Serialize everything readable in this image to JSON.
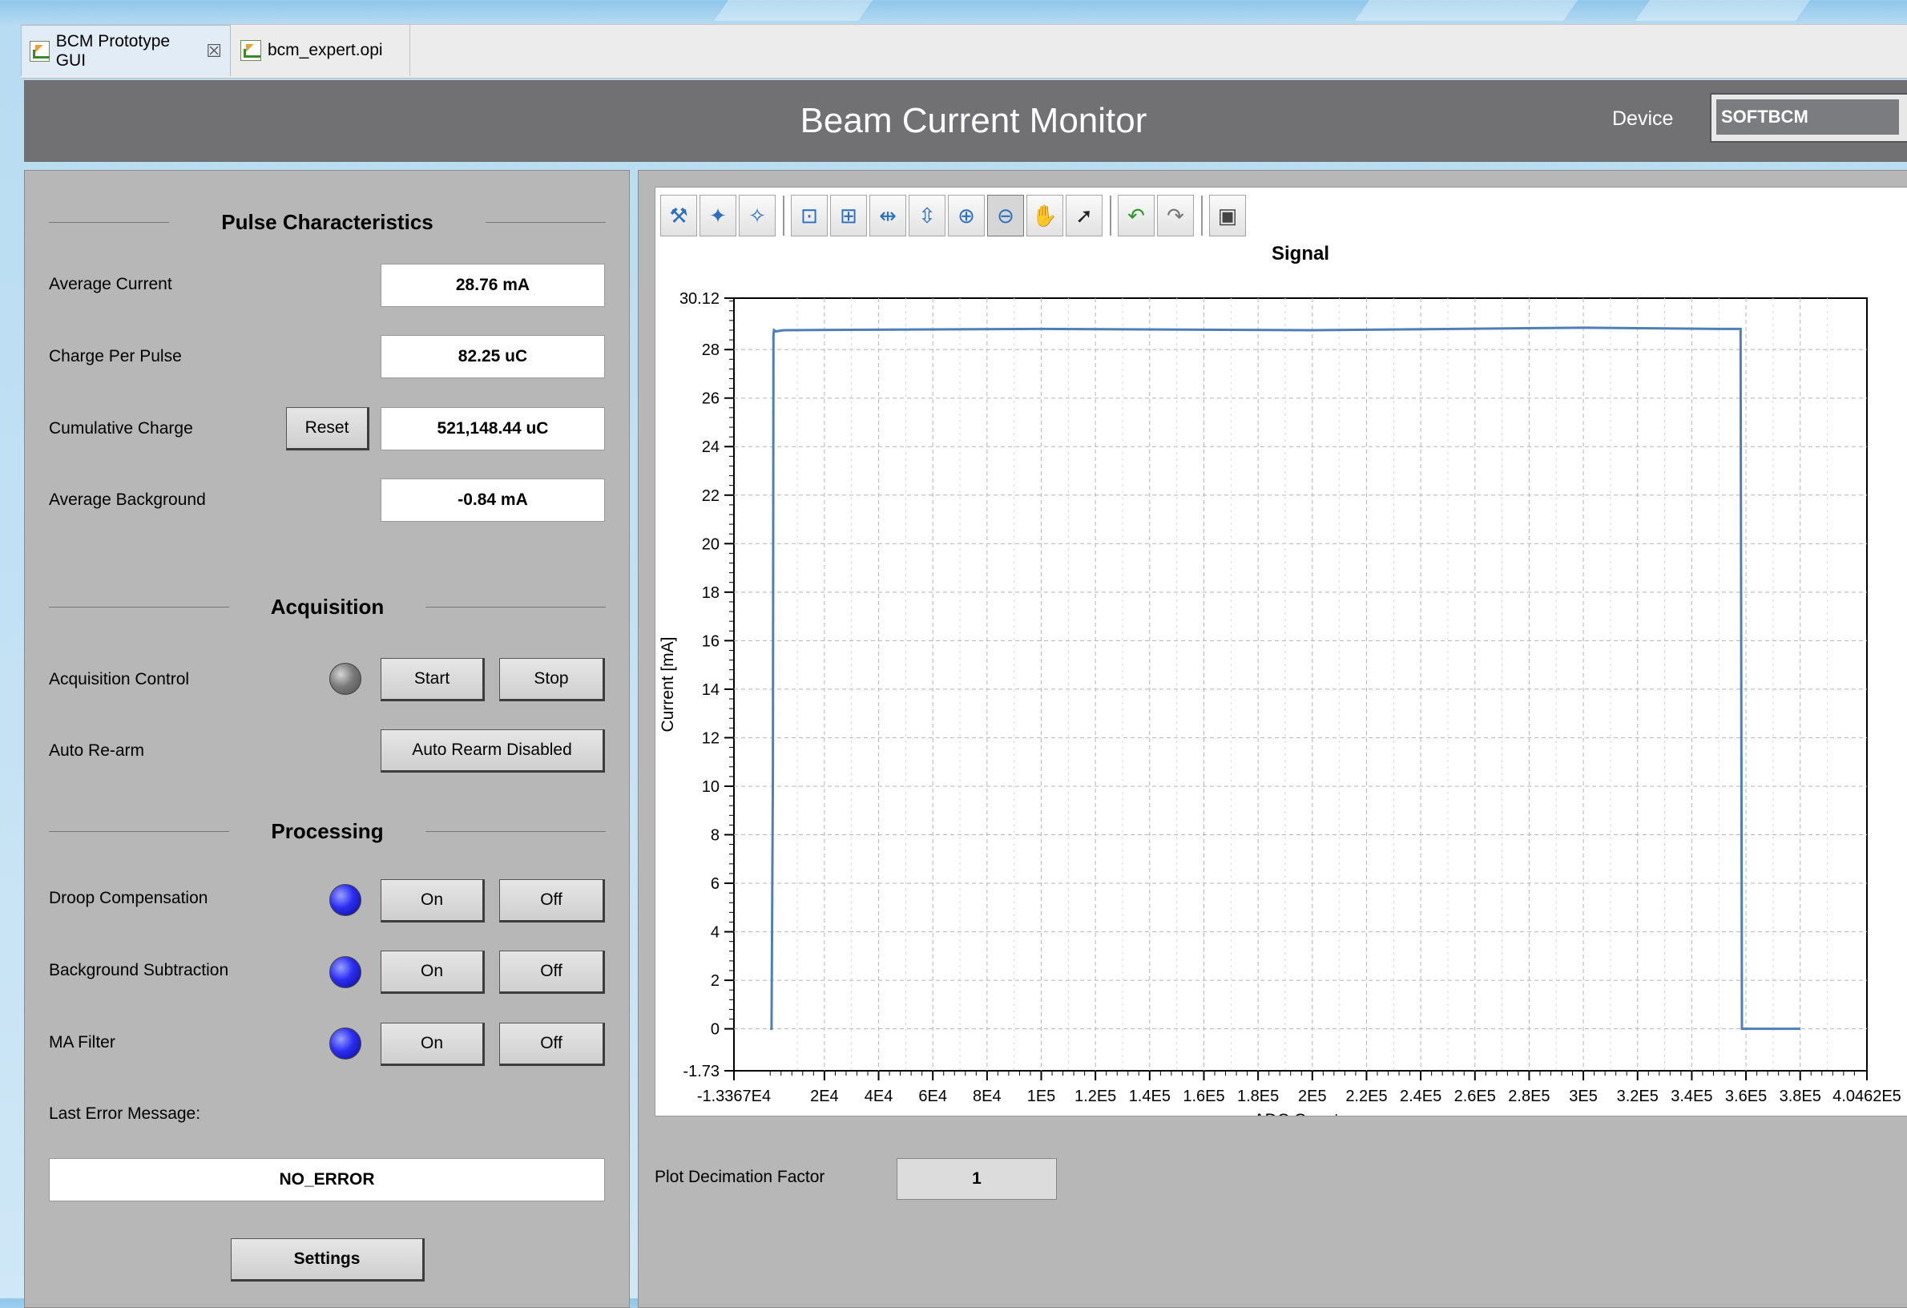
{
  "tabs": [
    {
      "label": "BCM Prototype GUI",
      "active": true,
      "closable": true,
      "icon": "chart-icon"
    },
    {
      "label": "bcm_expert.opi",
      "active": false,
      "closable": false,
      "icon": "chart-icon"
    }
  ],
  "header": {
    "title": "Beam Current Monitor",
    "device_label": "Device",
    "device_value": "SOFTBCM"
  },
  "left": {
    "pulse_title": "Pulse Characteristics",
    "average_current": {
      "label": "Average Current",
      "value": "28.76 mA"
    },
    "charge_per_pulse": {
      "label": "Charge Per Pulse",
      "value": "82.25 uC"
    },
    "cumulative_charge": {
      "label": "Cumulative Charge",
      "value": "521,148.44 uC",
      "reset_label": "Reset"
    },
    "average_background": {
      "label": "Average Background",
      "value": "-0.84 mA"
    },
    "acquisition_title": "Acquisition",
    "acquisition_control": {
      "label": "Acquisition Control",
      "start_label": "Start",
      "stop_label": "Stop",
      "led": "gray"
    },
    "auto_rearm": {
      "label": "Auto Re-arm",
      "button_label": "Auto Rearm Disabled"
    },
    "processing_title": "Processing",
    "droop": {
      "label": "Droop Compensation",
      "on_label": "On",
      "off_label": "Off",
      "led": "blue"
    },
    "background_sub": {
      "label": "Background Subtraction",
      "on_label": "On",
      "off_label": "Off",
      "led": "blue"
    },
    "ma_filter": {
      "label": "MA Filter",
      "on_label": "On",
      "off_label": "Off",
      "led": "blue"
    },
    "last_error_label": "Last Error Message:",
    "last_error_value": "NO_ERROR",
    "settings_label": "Settings"
  },
  "right": {
    "toolbar": [
      "configure-icon",
      "add-annotation-icon",
      "remove-annotation-icon",
      "autoscale-icon",
      "rubberband-zoom-icon",
      "horizontal-zoom-icon",
      "vertical-zoom-icon",
      "zoom-in-icon",
      "zoom-out-icon",
      "pan-icon",
      "pointer-icon",
      "undo-icon",
      "redo-icon",
      "snapshot-icon"
    ],
    "decimation_label": "Plot Decimation Factor",
    "decimation_value": "1"
  },
  "chart_data": {
    "type": "line",
    "title": "Signal",
    "xlabel": "ADC Counts",
    "ylabel": "Current [mA]",
    "xlim": [
      -13367,
      404620
    ],
    "ylim": [
      -1.73,
      30.12
    ],
    "grid": true,
    "x_tick_labels": [
      "-1.3367E4",
      "2E4",
      "4E4",
      "6E4",
      "8E4",
      "1E5",
      "1.2E5",
      "1.4E5",
      "1.6E5",
      "1.8E5",
      "2E5",
      "2.2E5",
      "2.4E5",
      "2.6E5",
      "2.8E5",
      "3E5",
      "3.2E5",
      "3.4E5",
      "3.6E5",
      "3.8E5",
      "4.0462E5"
    ],
    "x_tick_values": [
      -13367,
      20000,
      40000,
      60000,
      80000,
      100000,
      120000,
      140000,
      160000,
      180000,
      200000,
      220000,
      240000,
      260000,
      280000,
      300000,
      320000,
      340000,
      360000,
      380000,
      404620
    ],
    "y_tick_labels": [
      "-1.73",
      "0",
      "2",
      "4",
      "6",
      "8",
      "10",
      "12",
      "14",
      "16",
      "18",
      "20",
      "22",
      "24",
      "26",
      "28",
      "30.12"
    ],
    "y_tick_values": [
      -1.73,
      0,
      2,
      4,
      6,
      8,
      10,
      12,
      14,
      16,
      18,
      20,
      22,
      24,
      26,
      28,
      30.12
    ],
    "series": [
      {
        "color": "#4f7fb8",
        "x": [
          0,
          500,
          1000,
          1200,
          1400,
          2000,
          5000,
          100000,
          200000,
          300000,
          350000,
          358000,
          358500,
          359000,
          380000
        ],
        "y": [
          0,
          0,
          10.5,
          28.6,
          28.8,
          28.75,
          28.8,
          28.85,
          28.8,
          28.9,
          28.85,
          28.85,
          0,
          0,
          0
        ]
      }
    ]
  }
}
